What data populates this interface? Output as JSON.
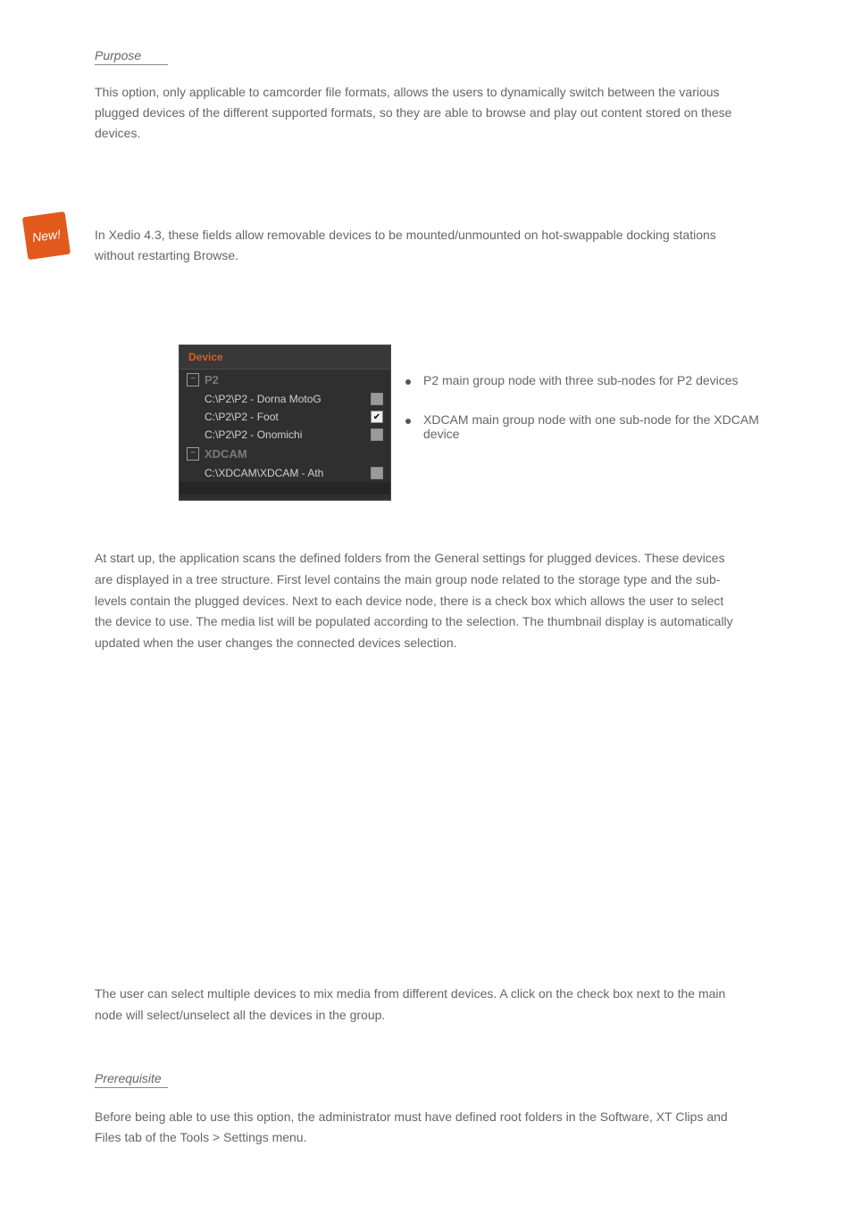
{
  "headings": {
    "purpose": "Purpose",
    "prerequisite": "Prerequisite"
  },
  "paragraphs": {
    "intro": "This option, only applicable to camcorder file formats, allows the users to dynamically switch between the various plugged devices of the different supported formats, so they are able to browse and play out content stored on these devices.",
    "sideNote": "In Xedio 4.3, these fields allow removable devices to be mounted/unmounted on hot-swappable docking stations without restarting Browse.",
    "bullet1": "P2 main group node with three sub-nodes for P2 devices",
    "bullet2": "XDCAM main group node with one sub-node for the XDCAM device",
    "main": "At start up, the application scans the defined folders from the General settings for plugged devices. These devices are displayed in a tree structure. First level contains the main group node related to the storage type and the sub-levels contain the plugged devices. Next to each device node, there is a check box which allows the user to select the device to use. The media list will be populated according to the selection. The thumbnail display is automatically updated when the user changes the connected devices selection.",
    "note": "The user can select multiple devices to mix media from different devices. A click on the check box next to the main node will select/unselect all the devices in the group.",
    "prereq": "Before being able to use this option, the administrator must have defined root folders in the Software, XT Clips and Files tab of the Tools > Settings menu."
  },
  "panel": {
    "title": "Device",
    "groups": [
      {
        "label": "P2",
        "items": [
          {
            "path": "C:\\P2\\P2 - Dorna MotoG",
            "checked": "grey"
          },
          {
            "path": "C:\\P2\\P2 - Foot",
            "checked": "true"
          },
          {
            "path": "C:\\P2\\P2 - Onomichi",
            "checked": "grey"
          }
        ]
      },
      {
        "label": "XDCAM",
        "items": [
          {
            "path": "C:\\XDCAM\\XDCAM - Ath",
            "checked": "grey"
          }
        ]
      }
    ]
  },
  "sticker": {
    "label": "New!"
  }
}
